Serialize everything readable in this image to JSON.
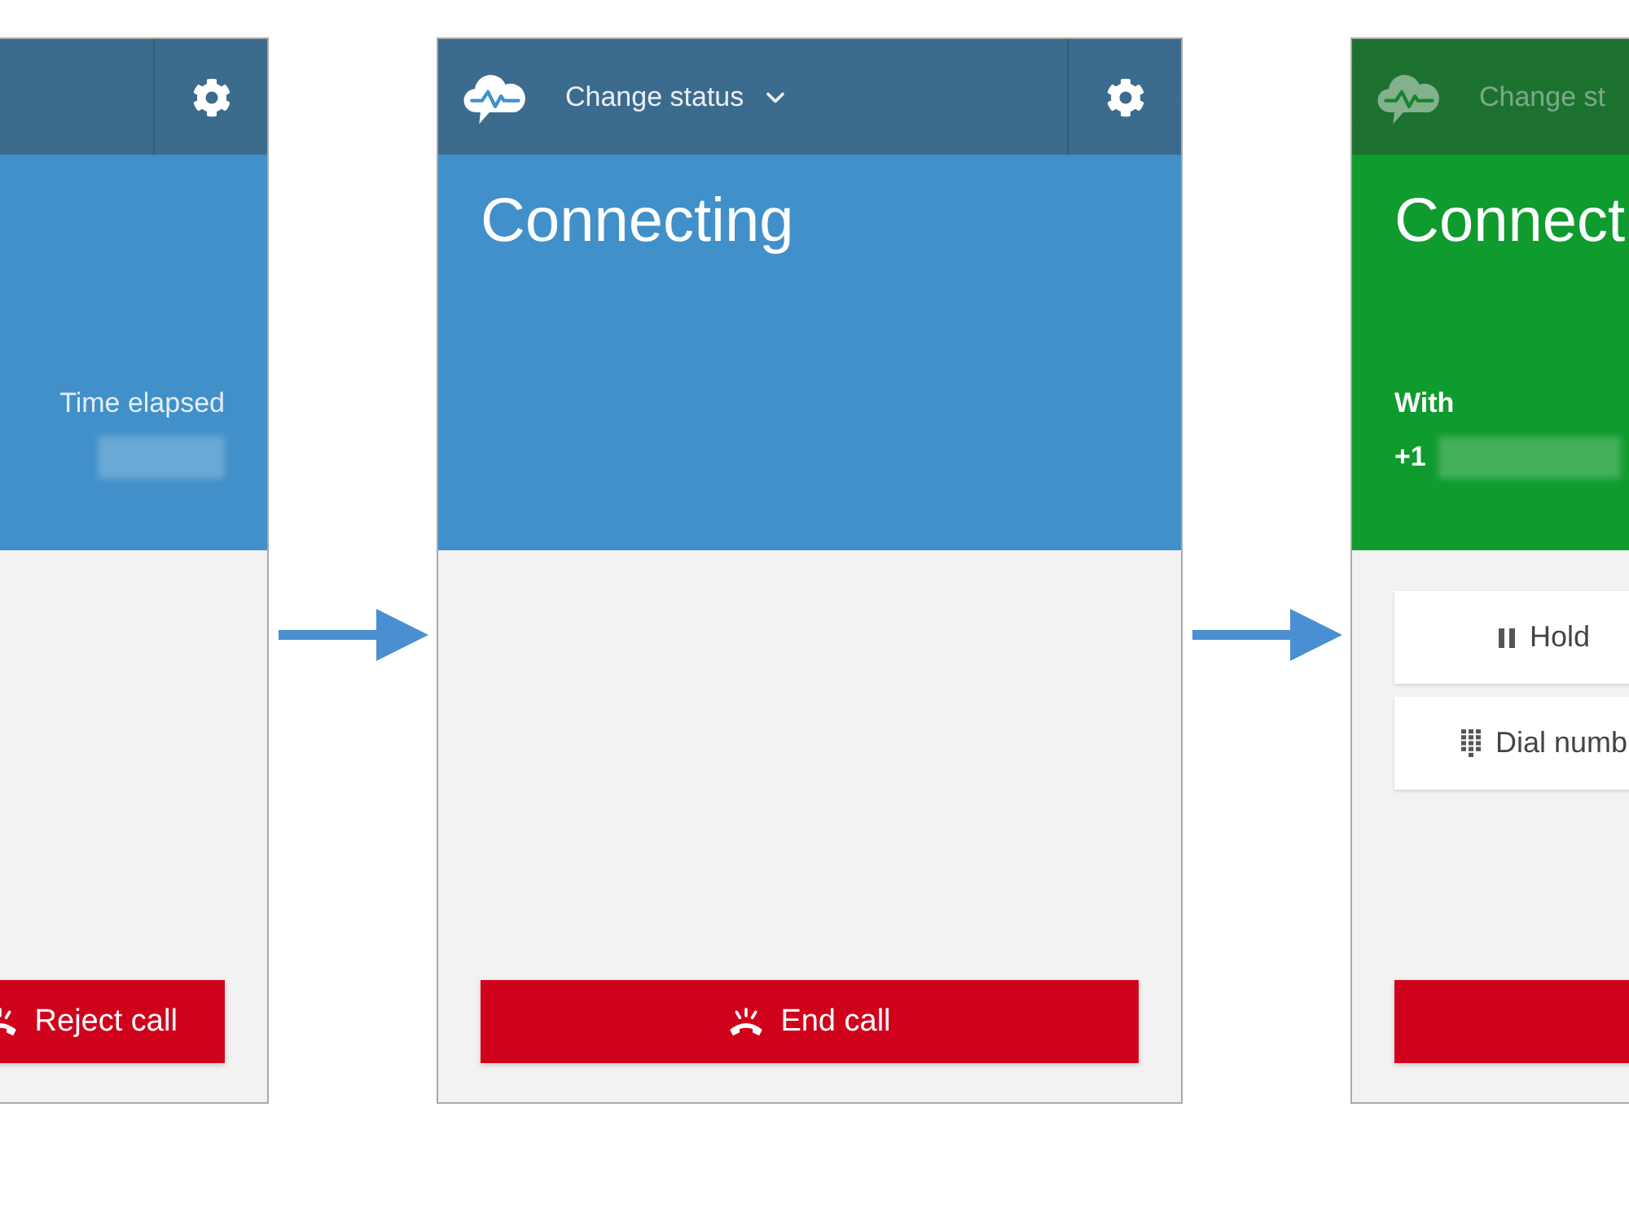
{
  "panels": [
    {
      "color": "#4190c9",
      "header": {
        "settings": true,
        "disabled": false
      },
      "status": {
        "info": {
          "kind": "timer",
          "label": "Time elapsed",
          "blurred_value": true
        }
      },
      "primary_button": {
        "kind": "reject_call",
        "label": "Reject call",
        "icon": true
      }
    },
    {
      "color": "#4190c9",
      "header": {
        "logo": true,
        "status_menu": {
          "label": "Change status",
          "dropdown": true
        },
        "settings": true,
        "disabled": false
      },
      "status": {
        "title": "Connecting"
      },
      "primary_button": {
        "kind": "end_call",
        "label": "End call",
        "icon": true
      }
    },
    {
      "color": "#0f9b2e",
      "header": {
        "logo": true,
        "status_menu": {
          "label": "Change st"
        },
        "disabled": true
      },
      "status": {
        "title": "Connect",
        "info": {
          "kind": "contact",
          "label": "With",
          "prefix": "+1",
          "blurred_value": true
        }
      },
      "actions": [
        {
          "kind": "hold",
          "label": "Hold"
        },
        {
          "kind": "dial_number",
          "label": "Dial numb"
        }
      ],
      "primary_button": {
        "kind": "end_call"
      }
    }
  ]
}
